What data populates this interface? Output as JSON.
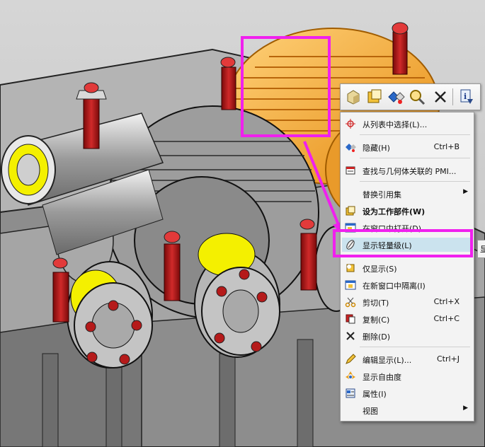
{
  "toolbar": {
    "buttons": [
      {
        "name": "select-component-icon"
      },
      {
        "name": "make-work-part-icon"
      },
      {
        "name": "hide-icon"
      },
      {
        "name": "find-pmi-icon"
      },
      {
        "name": "delete-x-icon"
      },
      {
        "name": "information-icon"
      }
    ]
  },
  "menu": {
    "items": [
      {
        "label": "从列表中选择(L)...",
        "shortcut": "",
        "icon": "crosshair-icon"
      },
      {
        "label": "隐藏(H)",
        "shortcut": "Ctrl+B",
        "icon": "hide-icon"
      },
      {
        "label": "查找与几何体关联的 PMI...",
        "shortcut": "",
        "icon": "pmi-icon"
      },
      {
        "label": "替换引用集",
        "shortcut": "",
        "icon": "",
        "submenu": true
      },
      {
        "label": "设为工作部件(W)",
        "shortcut": "",
        "icon": "work-part-icon",
        "bold": true
      },
      {
        "label": "在窗口中打开(D)",
        "shortcut": "",
        "icon": "open-window-icon"
      },
      {
        "label": "显示轻量级(L)",
        "shortcut": "",
        "icon": "lightweight-icon",
        "highlighted": true
      },
      {
        "label": "仅显示(S)",
        "shortcut": "",
        "icon": "show-only-icon"
      },
      {
        "label": "在新窗口中隔离(I)",
        "shortcut": "",
        "icon": "isolate-icon"
      },
      {
        "label": "剪切(T)",
        "shortcut": "Ctrl+X",
        "icon": "scissors-icon"
      },
      {
        "label": "复制(C)",
        "shortcut": "Ctrl+C",
        "icon": "copy-icon"
      },
      {
        "label": "删除(D)",
        "shortcut": "",
        "icon": "delete-icon"
      },
      {
        "label": "编辑显示(L)...",
        "shortcut": "Ctrl+J",
        "icon": "edit-display-icon"
      },
      {
        "label": "显示自由度",
        "shortcut": "",
        "icon": "dof-icon"
      },
      {
        "label": "属性(I)",
        "shortcut": "",
        "icon": "properties-icon"
      },
      {
        "label": "视图",
        "shortcut": "",
        "icon": "",
        "submenu": true
      }
    ]
  },
  "side_fragment": "显",
  "colors": {
    "highlight": "#cbe3ee",
    "annotation": "#f020ee",
    "selected_gear": "#f5a623",
    "bolt_red": "#b01515",
    "bearing_yellow": "#f4f000"
  }
}
